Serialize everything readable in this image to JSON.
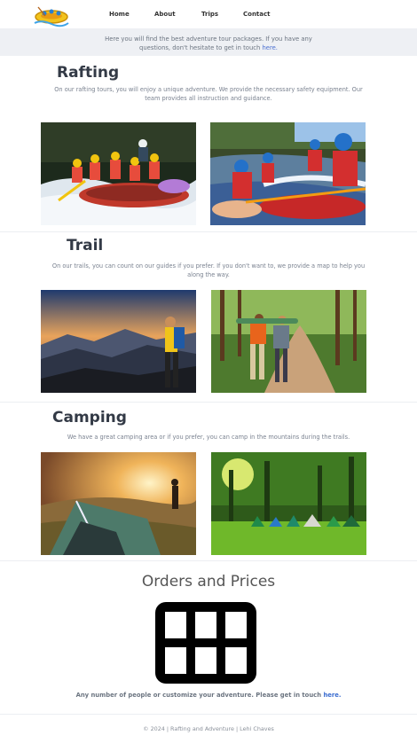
{
  "nav": {
    "logo_icon": "rafting-raft-logo-icon",
    "items": [
      "Home",
      "About",
      "Trips",
      "Contact"
    ]
  },
  "banner": {
    "line1": "Here you will find the best adventure tour packages. If you have any",
    "line2_prefix": "questions, don't hesitate to get in touch",
    "line2_link": "here."
  },
  "sections": {
    "rafting": {
      "title": "Rafting",
      "line1": "On our rafting tours, you will enjoy a unique adventure. We provide the necessary safety equipment. Our",
      "line2": "team provides all instruction and guidance."
    },
    "trail": {
      "title": "Trail",
      "line1": "On our trails, you can count on our guides if you prefer. If you don't want to, we provide a map to help you",
      "line2": "along the way."
    },
    "camping": {
      "title": "Camping",
      "line1": "We have a great camping area or if you prefer, you can camp in the mountains during the trails."
    }
  },
  "orders": {
    "title": "Orders and Prices",
    "icon": "table-grid-icon",
    "note_prefix": "Any number of people or customize your adventure. Please get in touch",
    "note_link": "here."
  },
  "footer": {
    "text": "© 2024 | Rafting and Adventure | Lehi Chaves"
  },
  "colors": {
    "banner_bg": "#eef0f4",
    "link": "#3a6cd0",
    "heading": "#333a46"
  }
}
